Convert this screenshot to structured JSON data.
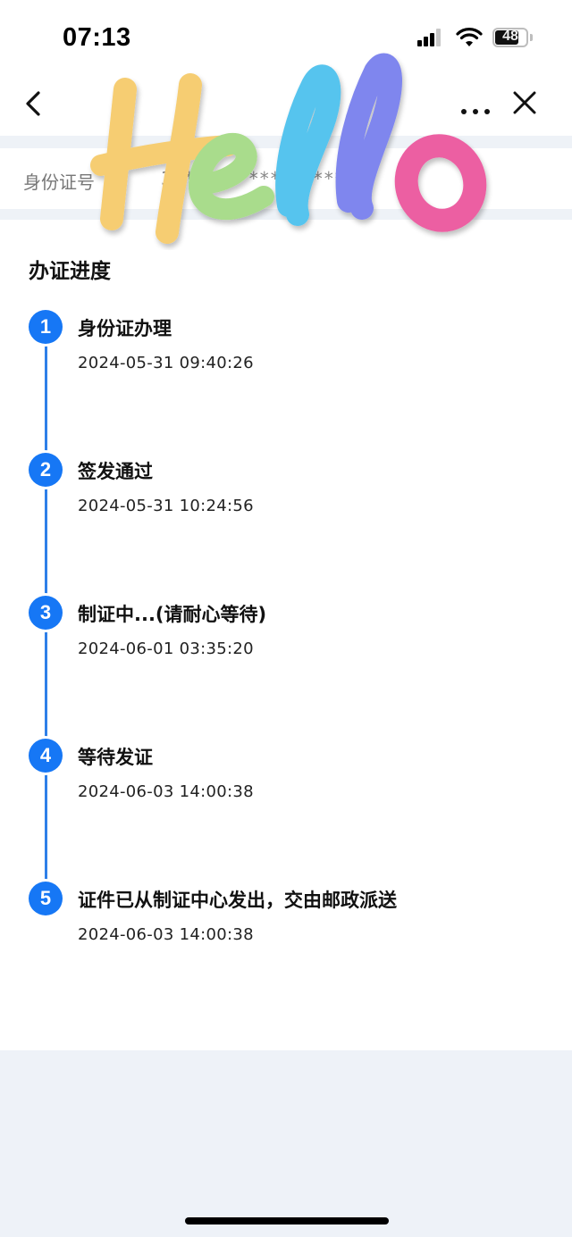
{
  "status_bar": {
    "time": "07:13",
    "battery": "48"
  },
  "nav": {
    "back_icon": "chevron-left-icon",
    "more_icon": "more-dots-icon",
    "close_icon": "close-icon"
  },
  "id_row": {
    "label": "身份证号",
    "value": "3****************7"
  },
  "progress": {
    "title": "办证进度",
    "steps": [
      {
        "num": "1",
        "title": "身份证办理",
        "time": "2024-05-31 09:40:26"
      },
      {
        "num": "2",
        "title": "签发通过",
        "time": "2024-05-31 10:24:56"
      },
      {
        "num": "3",
        "title": "制证中...(请耐心等待)",
        "time": "2024-06-01 03:35:20"
      },
      {
        "num": "4",
        "title": "等待发证",
        "time": "2024-06-03 14:00:38"
      },
      {
        "num": "5",
        "title": "证件已从制证中心发出，交由邮政派送",
        "time": "2024-06-03 14:00:38"
      }
    ]
  },
  "sticker": {
    "text": "Hello",
    "colors": [
      "#f6cd72",
      "#a9dc8c",
      "#56c4ee",
      "#7f86ee",
      "#ec5fa2"
    ]
  },
  "colors": {
    "accent": "#1677f5",
    "timeline": "#2e7fe8",
    "page_bg": "#eef2f8"
  }
}
